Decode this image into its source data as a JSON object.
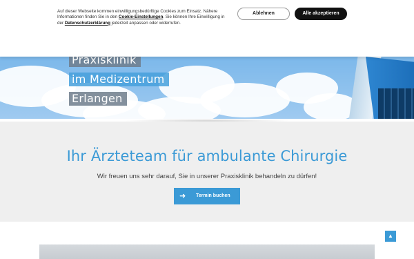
{
  "cookie_banner": {
    "text_part1": "Auf dieser Webseite kommen einwilligungsbedürftige Cookies zum Einsatz. Nähere Informationen finden Sie in den ",
    "link_settings": "Cookie-Einstellungen",
    "text_part2": ". Sie können Ihre Einwilligung in der ",
    "link_privacy": "Datenschutzerklärung",
    "text_part3": " jederzeit anpassen oder widerrufen.",
    "decline_label": "Ablehnen",
    "accept_label": "Alle akzeptieren"
  },
  "hero": {
    "lines": [
      "Praxisklinik",
      "im Medizentrum",
      "Erlangen"
    ]
  },
  "main": {
    "headline": "Ihr Ärzteteam für ambulante Chirurgie",
    "subline": "Wir freuen uns sehr darauf, Sie in unserer Praxisklinik behandeln zu dürfen!",
    "cta_label": "Termin buchen",
    "cta_icon": "arrow-right-icon"
  },
  "back_to_top_icon": "chevron-up-icon",
  "colors": {
    "accent": "#3b9ad6",
    "accept_button": "#111111",
    "band_background": "#efefef"
  }
}
